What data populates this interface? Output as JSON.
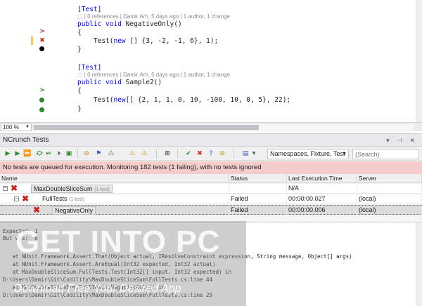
{
  "editor": {
    "blocks": [
      {
        "attribute": "[Test]",
        "lens": "| 0 references | Damir Arh, 5 days ago | 1 author, 1 change",
        "signature_kw": "public void ",
        "signature_rest": "NegativeOnly()",
        "open_brace": "{",
        "body_prefix": "    Test(",
        "body_kw": "new",
        "body_rest": " [] {3, -2, -1, 6}, 1);",
        "close_brace": "}"
      },
      {
        "attribute": "[Test]",
        "lens": "| 0 references | Damir Arh, 5 days ago | 1 author, 1 change",
        "signature_kw": "public void ",
        "signature_rest": "Sample2()",
        "open_brace": "{",
        "body_prefix": "    Test(",
        "body_kw": "new",
        "body_rest": "[] {2, 1, 1, 0, 10, -100, 10, 0, 5}, 22);",
        "close_brace": "}"
      }
    ],
    "zoom": "100 %"
  },
  "ncrunch": {
    "title": "NCrunch Tests",
    "panel_controls": "▾ ⊣ ✕",
    "filter_select": "Namespaces, Fixture, Test",
    "search_placeholder": "(Search)",
    "status_message": "No tests are queued for execution.  Monitoring 182 tests (1 failing), with no tests ignored",
    "columns": [
      "Name",
      "Status",
      "Last Execution Time",
      "Server"
    ],
    "rows": [
      {
        "name": "MaxDoubleSliceSum",
        "count": "(1 test)",
        "status": "",
        "time": "N/A",
        "server": ""
      },
      {
        "name": "FullTests",
        "count": "(1 test)",
        "status": "Failed",
        "time": "00:00:00.027",
        "server": "(local)"
      },
      {
        "name": "NegativeOnly",
        "count": "",
        "status": "Failed",
        "time": "00:00:00.006",
        "server": "(local)"
      }
    ],
    "output_lines": [
      "Expected: 1",
      "But was:  0",
      "",
      "   at NUnit.Framework.Assert.That(Object actual, IResolveConstraint expression, String message, Object[] args)",
      "   at NUnit.Framework.Assert.AreEqual(Int32 expected, Int32 actual)",
      "   at MaxDoubleSliceSum.FullTests.Test(Int32[] input, Int32 expected) in",
      "D:\\Users\\Damir\\Git\\Codility\\MaxDoubleSliceSum\\FullTests.cs:line 44",
      "   at MaxDoubleSliceSum.FullTests.NegativeOnly() in",
      "D:\\Users\\Damir\\Git\\Codility\\MaxDoubleSliceSum\\FullTests.cs:line 29"
    ]
  },
  "watermark": {
    "title": "GET INTO PC",
    "subtitle": "Download Free Your Desired App"
  },
  "colors": {
    "keyword": "#0000ff",
    "fail_red": "#d0221b",
    "pass_green": "#2a8a25",
    "status_bar_bg": "#f4cccc"
  }
}
